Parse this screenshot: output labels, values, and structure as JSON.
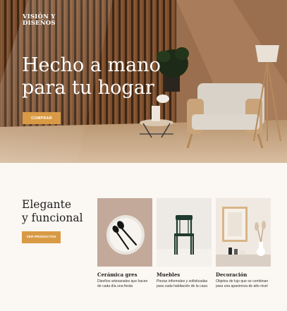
{
  "brand": {
    "line1": "VISIÓN Y",
    "line2": "DISEÑOS"
  },
  "hero": {
    "title_line1": "Hecho a mano",
    "title_line2": "para tu hogar",
    "cta": "COMPRAR"
  },
  "feature": {
    "title_line1": "Elegante",
    "title_line2": "y funcional",
    "cta": "VER PRODUCTOS"
  },
  "products": [
    {
      "name": "Cerámica gres",
      "desc_line1": "Diseños artesanales que hacen",
      "desc_line2": "de cada día una fiesta",
      "icon": "ceramic-plate-icon"
    },
    {
      "name": "Muebles",
      "desc_line1": "Piezas informales y sofisticadas",
      "desc_line2": "para cada habitación de la casa",
      "icon": "chair-icon"
    },
    {
      "name": "Decoración",
      "desc_line1": "Objetos de lujo que se combinan",
      "desc_line2": "para una apariencia de alto nivel",
      "icon": "decor-frame-icon"
    }
  ],
  "colors": {
    "accent": "#d99a45",
    "background": "#fbf7f3",
    "text": "#1e1e1e"
  }
}
